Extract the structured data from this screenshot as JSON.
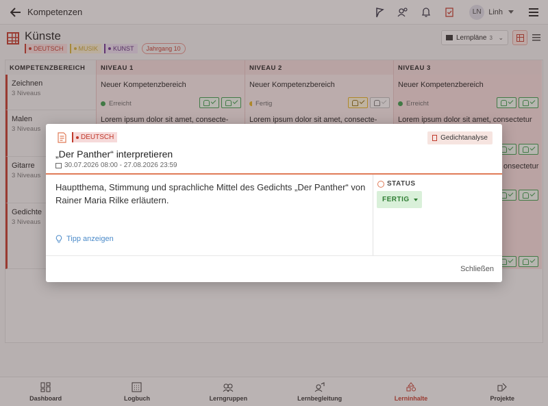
{
  "topbar": {
    "back_label": "Kompetenzen",
    "user_initials": "LN",
    "user_name": "Linh",
    "icons": [
      "flag-icon",
      "user-settings-icon",
      "bell-icon",
      "task-check-icon",
      "menu-icon"
    ]
  },
  "page": {
    "title": "Künste",
    "tags": [
      "DEUTSCH",
      "MUSIK",
      "KUNST"
    ],
    "grade_pill": "Jahrgang 10",
    "lernplaene_label": "Lernpläne",
    "lernplaene_count": "3"
  },
  "table": {
    "headers": [
      "KOMPETENZBEREICH",
      "NIVEAU 1",
      "NIVEAU 2",
      "NIVEAU 3"
    ],
    "rows": [
      {
        "name": "Zeichnen",
        "sub": "3 Niveaus"
      },
      {
        "name": "Malen",
        "sub": "3 Niveaus"
      },
      {
        "name": "Gitarre",
        "sub": "3 Niveaus"
      },
      {
        "name": "Gedichte",
        "sub": "3 Niveaus"
      }
    ],
    "cells": [
      {
        "title": "Neuer Kompetenzbereich",
        "status": "Erreicht",
        "desc": "Lorem ipsum dolor sit amet, consecte-"
      },
      {
        "title": "Neuer Kompetenzbereich",
        "status": "Fertig",
        "desc": "Lorem ipsum dolor sit amet, consecte-"
      },
      {
        "title": "Neuer Kompetenzbereich",
        "status": "Erreicht",
        "desc": "Lorem ipsum dolor sit amet, consectetur",
        "desc2": "onsectetur"
      }
    ]
  },
  "modal": {
    "subject": "DEUTSCH",
    "category": "Gedichtanalyse",
    "title": "„Der Panther“ interpretieren",
    "date_range": "30.07.2026 08:00 - 27.08.2026 23:59",
    "body": "Hauptthema, Stimmung und sprachliche Mittel des Gedichts „Der Panther“ von Rainer Maria Rilke erläutern.",
    "status_label": "STATUS",
    "status_value": "FERTIG",
    "tip_label": "Tipp anzeigen",
    "close_label": "Schließen"
  },
  "bottom_nav": [
    {
      "label": "Dashboard",
      "icon": "dashboard-icon"
    },
    {
      "label": "Logbuch",
      "icon": "calendar-icon"
    },
    {
      "label": "Lerngruppen",
      "icon": "group-icon"
    },
    {
      "label": "Lernbegleitung",
      "icon": "coaching-icon"
    },
    {
      "label": "Lerninhalte",
      "icon": "content-icon",
      "active": true
    },
    {
      "label": "Projekte",
      "icon": "projects-icon"
    }
  ],
  "colors": {
    "accent": "#c0392b",
    "success": "#3a9a4a",
    "warning": "#e0b020",
    "link": "#4a8ac9"
  }
}
